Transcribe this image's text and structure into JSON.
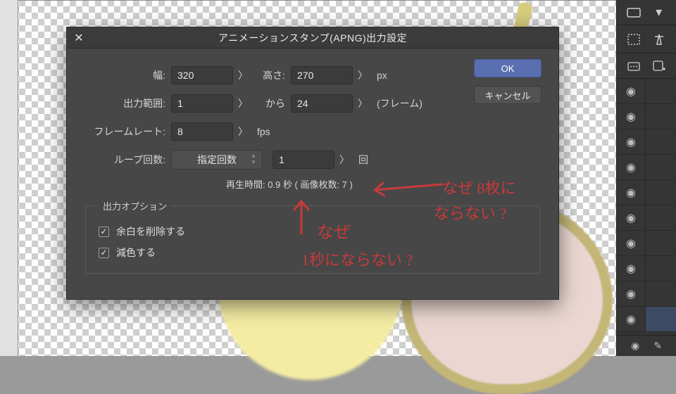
{
  "dialog": {
    "title": "アニメーションスタンプ(APNG)出力設定",
    "width_label": "幅:",
    "width_value": "320",
    "height_label": "高さ:",
    "height_value": "270",
    "size_unit": "px",
    "range_label": "出力範囲:",
    "range_from": "1",
    "range_to_label": "から",
    "range_to": "24",
    "range_unit": "(フレーム)",
    "fps_label": "フレームレート:",
    "fps_value": "8",
    "fps_unit": "fps",
    "loop_label": "ループ回数:",
    "loop_select": "指定回数",
    "loop_value": "1",
    "loop_unit": "回",
    "playtime": "再生時間: 0.9 秒 ( 画像枚数: 7 )",
    "opts_legend": "出力オプション",
    "opt_trim": "余白を削除する",
    "opt_reduce": "減色する",
    "ok": "OK",
    "cancel": "キャンセル"
  },
  "annotations": {
    "a1_line1": "なぜ 8枚に",
    "a1_line2": "ならない ?",
    "a2_line1": "なぜ",
    "a2_line2": "1秒にならない ?"
  }
}
